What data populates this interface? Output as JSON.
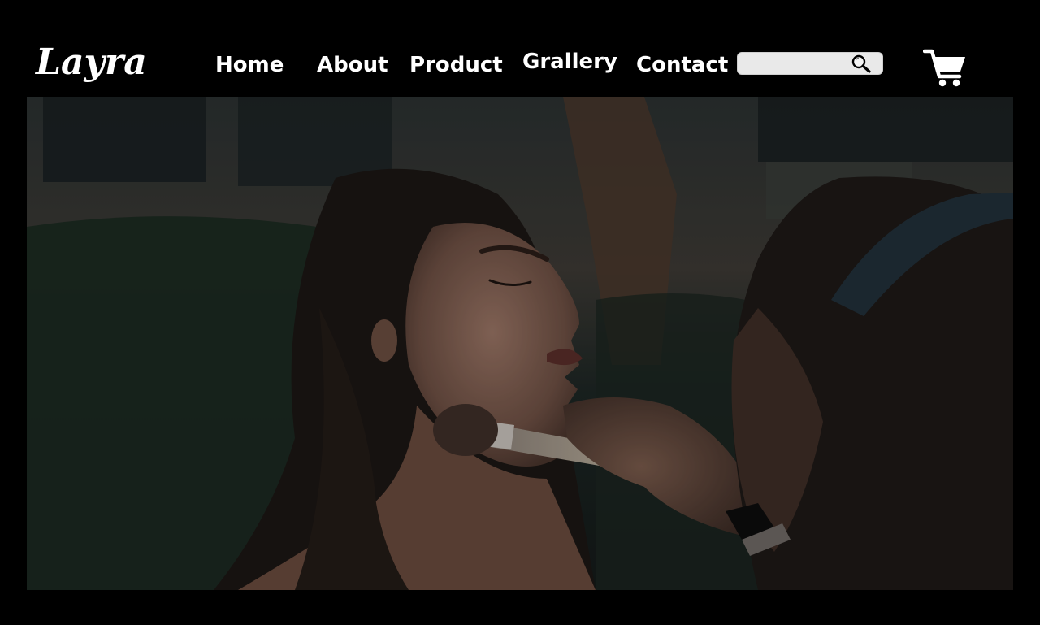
{
  "brand": {
    "name": "Layra"
  },
  "nav": {
    "home": "Home",
    "about": "About",
    "product": "Product",
    "gallery": "Grallery",
    "contact": "Contact"
  },
  "search": {
    "placeholder": "",
    "value": "",
    "icon": "search-icon"
  },
  "cart": {
    "icon": "cart-icon"
  },
  "hero": {
    "image": "hero-makeup-photo"
  },
  "colors": {
    "background": "#000000",
    "text": "#ffffff",
    "search_bg": "#e9e9e9"
  }
}
